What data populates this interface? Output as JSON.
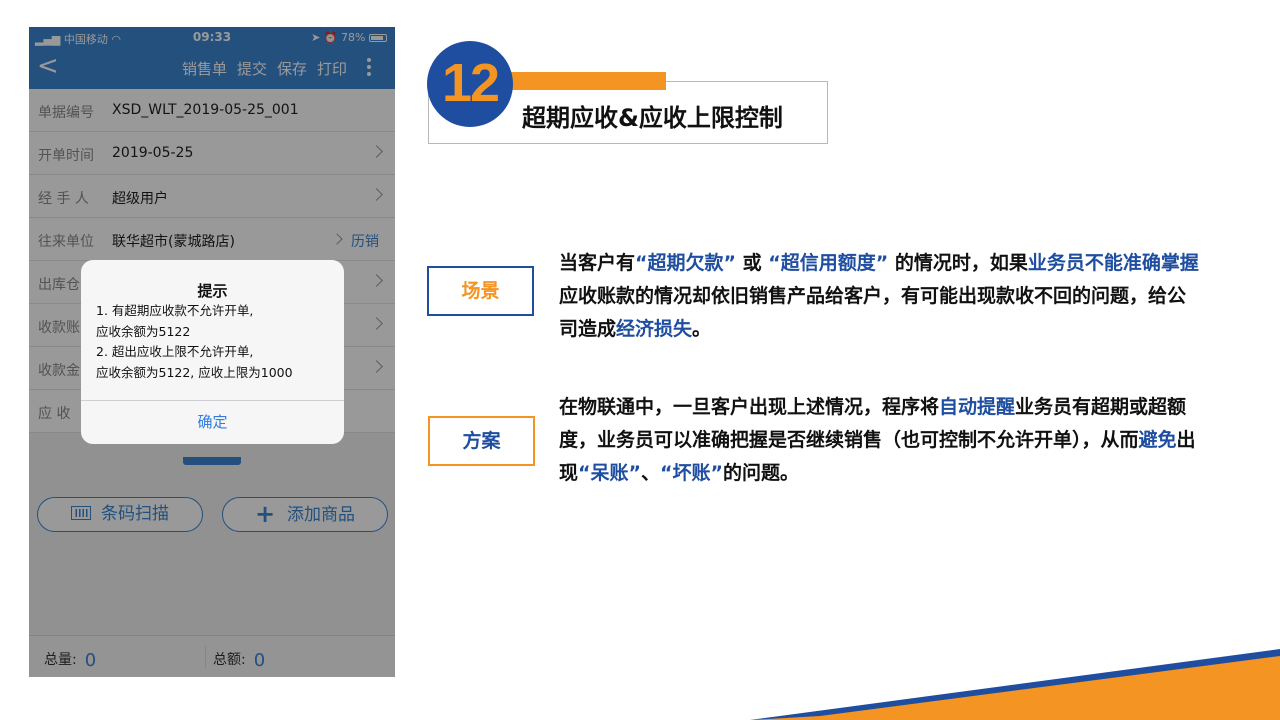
{
  "phone": {
    "status": {
      "carrier": "中国移动",
      "time": "09:33",
      "battery": "78%"
    },
    "nav": {
      "actions": [
        "销售单",
        "提交",
        "保存",
        "打印"
      ]
    },
    "form": [
      {
        "label": "单据编号",
        "value": "XSD_WLT_2019-05-25_001"
      },
      {
        "label": "开单时间",
        "value": "2019-05-25"
      },
      {
        "label": "经 手 人",
        "value": "超级用户"
      },
      {
        "label": "往来单位",
        "value": "联华超市(蒙城路店)",
        "extra": "历销"
      },
      {
        "label": "出库仓",
        "value": ""
      },
      {
        "label": "收款账",
        "value": ""
      },
      {
        "label": "收款金",
        "value": ""
      },
      {
        "label": "应 收",
        "value": ""
      }
    ],
    "buttons": {
      "scan": "条码扫描",
      "add": "添加商品"
    },
    "footer": {
      "qty_label": "总量:",
      "qty": "0",
      "amt_label": "总额:",
      "amt": "0"
    },
    "alert": {
      "title": "提示",
      "lines": [
        "1. 有超期应收款不允许开单,",
        "应收余额为5122",
        "2. 超出应收上限不允许开单,",
        "应收余额为5122, 应收上限为1000"
      ],
      "confirm": "确定"
    }
  },
  "slide": {
    "number": "12",
    "title": "超期应收&应收上限控制",
    "tag_scene": "场景",
    "tag_plan": "方案",
    "p1": [
      {
        "t": "当客户有"
      },
      {
        "t": "“超期欠款”",
        "c": "b"
      },
      {
        "t": " 或 "
      },
      {
        "t": "“超信用额度”",
        "c": "b"
      },
      {
        "t": " 的情况时，如果"
      },
      {
        "t": "业务员不能准确掌握",
        "c": "b"
      },
      {
        "t": "应收账款的情况却依旧销售产品给客户，有可能出现款收不回的问题，给公司造成"
      },
      {
        "t": "经济损失",
        "c": "b"
      },
      {
        "t": "。"
      }
    ],
    "p2": [
      {
        "t": "在物联通中，一旦客户出现上述情况，程序将"
      },
      {
        "t": "自动提醒",
        "c": "b"
      },
      {
        "t": "业务员有超期或超额度，业务员可以准确把握是否继续销售（也可控制不允许开单），从而"
      },
      {
        "t": "避免",
        "c": "b"
      },
      {
        "t": "出现"
      },
      {
        "t": "“呆账”",
        "c": "b"
      },
      {
        "t": "、"
      },
      {
        "t": "“坏账”",
        "c": "b"
      },
      {
        "t": "的问题。"
      }
    ]
  },
  "colors": {
    "brand_blue": "#1f4ea0",
    "accent_orange": "#f39423",
    "app_blue": "#3d86d3"
  }
}
